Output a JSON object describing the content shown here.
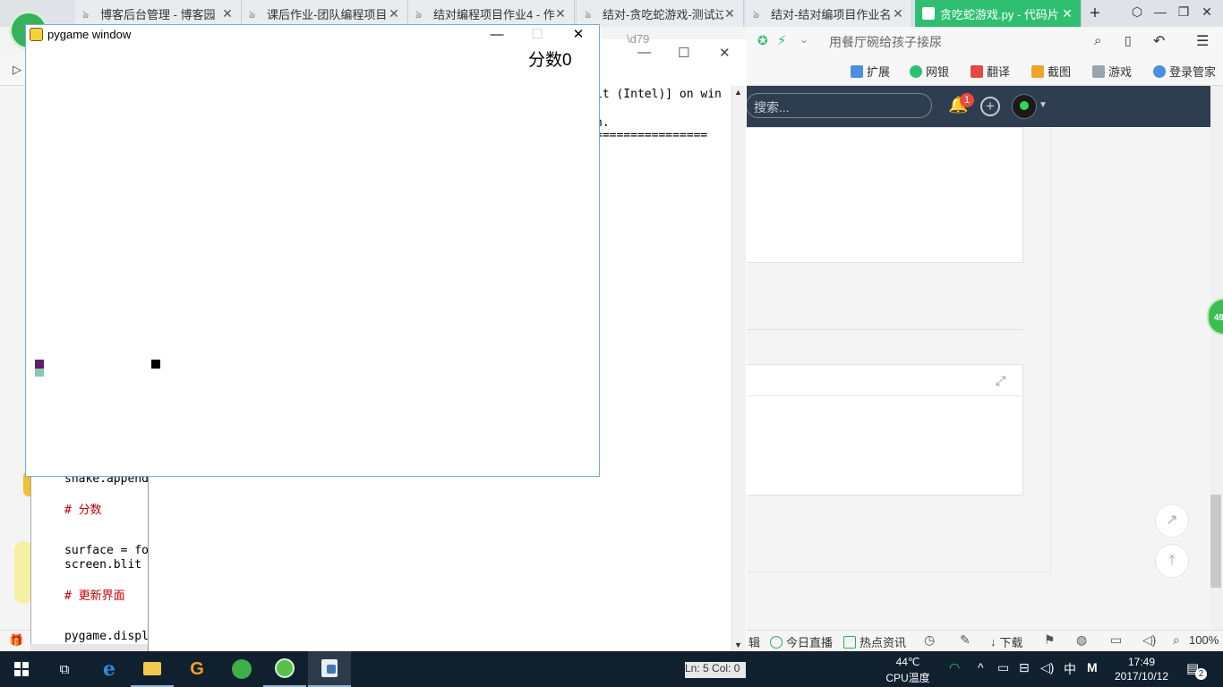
{
  "browser": {
    "tabs": [
      {
        "label": "博客后台管理 - 博客园",
        "active": false
      },
      {
        "label": "课后作业-团队编程项目",
        "active": false
      },
      {
        "label": "结对编程项目作业4 - 作",
        "active": false
      },
      {
        "label": "结对-贪吃蛇游戏-测试过",
        "active": false
      },
      {
        "label": "结对-结对编项目作业名",
        "active": false
      },
      {
        "label": "贪吃蛇游戏.py - 代码片",
        "active": true
      }
    ],
    "new_tab": "+",
    "address_text": "用餐厅碗给孩子接尿",
    "extensions": [
      "扩展",
      "网银",
      "翻译",
      "截图",
      "游戏",
      "登录管家"
    ],
    "status_items": [
      "今日直播",
      "热点资讯",
      "下载"
    ],
    "zoom": "100%",
    "status_partial": "辑"
  },
  "blog": {
    "search_placeholder": "搜索...",
    "notification_count": "1",
    "green_badge": "49"
  },
  "idle": {
    "partial_tab": "\\d79",
    "shell_lines": [
      "it (Intel)] on win",
      "n.",
      "================"
    ],
    "code_lines": [
      {
        "text": "snake.append",
        "type": "plain"
      },
      {
        "text": "# 分数",
        "type": "comment"
      },
      {
        "text": "surface = fo",
        "type": "plain"
      },
      {
        "text": "screen.blit",
        "type": "plain"
      },
      {
        "text": "# 更新界面",
        "type": "comment"
      },
      {
        "text": "pygame.displ",
        "type": "plain"
      }
    ],
    "status": "Ln: 5 Col: 0"
  },
  "pygame": {
    "title": "pygame window",
    "score_text": "分数0",
    "colors": {
      "head": "#5b1f6b",
      "body": "#8cc9a8",
      "food": "#000000"
    }
  },
  "taskbar": {
    "temperature": "44℃",
    "temperature_label": "CPU温度",
    "ime": "中",
    "ime2": "M",
    "time": "17:49",
    "date": "2017/10/12",
    "notification_count": "2"
  }
}
